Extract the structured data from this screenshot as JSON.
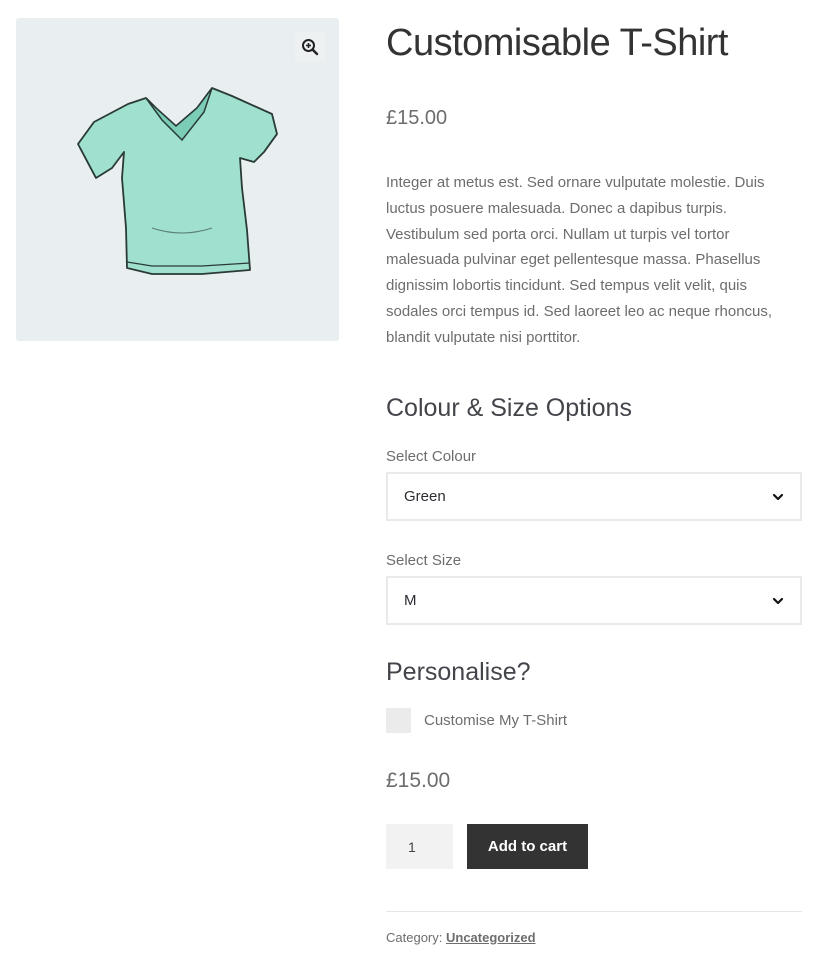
{
  "product": {
    "title": "Customisable T-Shirt",
    "price": "£15.00",
    "description": "Integer at metus est. Sed ornare vulputate molestie. Duis luctus posuere malesuada. Donec a dapibus turpis. Vestibulum sed porta orci. Nullam ut turpis vel tortor malesuada pulvinar eget pellentesque massa. Phasellus dignissim lobortis tincidunt. Sed tempus velit velit, quis sodales orci tempus id. Sed laoreet leo ac neque rhoncus, blandit vulputate nisi porttitor."
  },
  "gallery": {
    "zoom_icon": "zoom-in-icon",
    "image_icon": "t-shirt-icon",
    "shirt_color": "#9fe0cf"
  },
  "options": {
    "heading": "Colour & Size Options",
    "colour_label": "Select Colour",
    "colour_value": "Green",
    "size_label": "Select Size",
    "size_value": "M"
  },
  "personalise": {
    "heading": "Personalise?",
    "checkbox_label": "Customise My T-Shirt",
    "checked": false
  },
  "cart": {
    "total_price": "£15.00",
    "quantity": "1",
    "button_label": "Add to cart"
  },
  "meta": {
    "category_label": "Category:",
    "category_value": "Uncategorized"
  },
  "colors": {
    "button_bg": "#333333",
    "text_muted": "#6d6d6d",
    "gallery_bg": "#e9eff1"
  }
}
